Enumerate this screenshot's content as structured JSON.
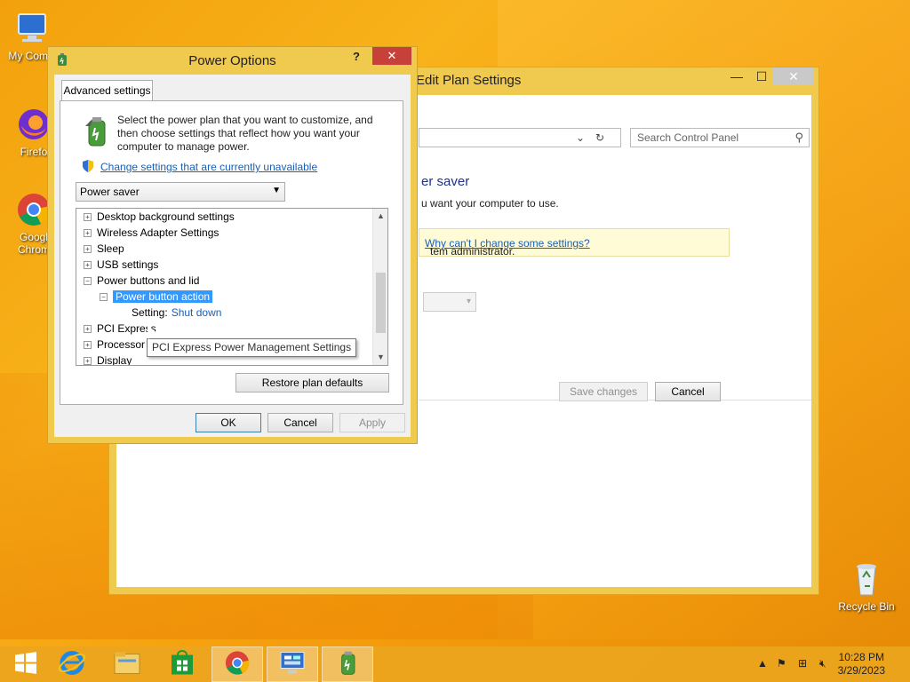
{
  "desktop": {
    "icons": [
      {
        "label": "My Comp",
        "icon": "computer-icon"
      },
      {
        "label": "Firefo",
        "icon": "firefox-icon"
      },
      {
        "label": "Googl\nChrom",
        "icon": "chrome-icon"
      },
      {
        "label": "Recycle Bin",
        "icon": "recycle-bin-icon"
      }
    ]
  },
  "back_window": {
    "title": "Edit Plan Settings",
    "search_placeholder": "Search Control Panel",
    "plan_heading": "er saver",
    "plan_desc": "u want your computer to use.",
    "admin_text": "tem administrator.",
    "admin_link": "Why can't I change some settings?",
    "save_label": "Save changes",
    "cancel_label": "Cancel",
    "controls": {
      "minimize": "—",
      "maximize": "☐",
      "close": "✕"
    }
  },
  "dialog": {
    "title": "Power Options",
    "help": "?",
    "close": "✕",
    "tab": "Advanced settings",
    "intro": "Select the power plan that you want to customize, and then choose settings that reflect how you want your computer to manage power.",
    "change_link": "Change settings that are currently unavailable",
    "plan_selected": "Power saver",
    "tree": [
      {
        "label": "Desktop background settings",
        "expander": "+",
        "indent": 0
      },
      {
        "label": "Wireless Adapter Settings",
        "expander": "+",
        "indent": 0
      },
      {
        "label": "Sleep",
        "expander": "+",
        "indent": 0
      },
      {
        "label": "USB settings",
        "expander": "+",
        "indent": 0
      },
      {
        "label": "Power buttons and lid",
        "expander": "−",
        "indent": 0
      },
      {
        "label": "Power button action",
        "expander": "−",
        "indent": 1,
        "selected": true
      },
      {
        "label": "Setting:",
        "value": "Shut down",
        "indent": 2
      },
      {
        "label": "PCI Express",
        "expander": "+",
        "indent": 0
      },
      {
        "label": "Processor",
        "expander": "+",
        "indent": 0
      },
      {
        "label": "Display",
        "expander": "+",
        "indent": 0
      }
    ],
    "tooltip": "PCI Express Power Management Settings",
    "restore_label": "Restore plan defaults",
    "ok_label": "OK",
    "cancel_label": "Cancel",
    "apply_label": "Apply"
  },
  "taskbar": {
    "items": [
      "start-icon",
      "internet-explorer-icon",
      "file-explorer-icon",
      "store-icon",
      "chrome-icon",
      "control-panel-icon",
      "power-options-icon"
    ],
    "time": "10:28 PM",
    "date": "3/29/2023"
  }
}
